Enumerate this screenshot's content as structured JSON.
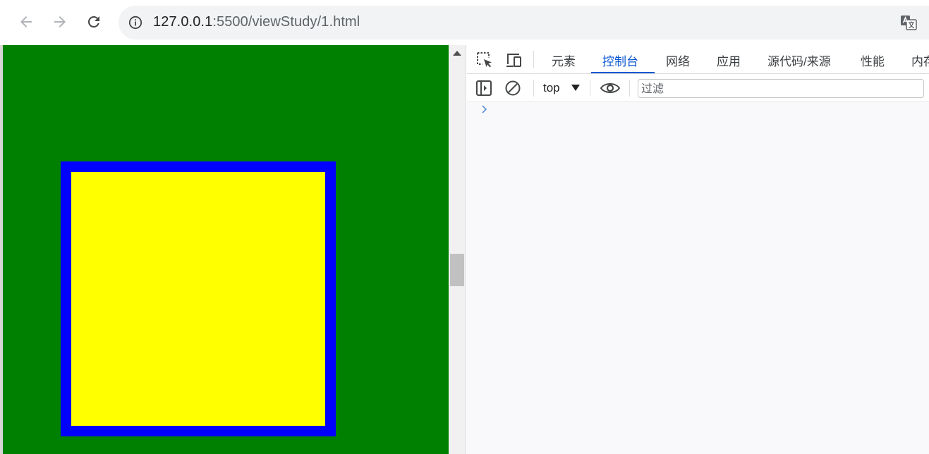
{
  "browser": {
    "url_host": "127.0.0.1",
    "url_rest": ":5500/viewStudy/1.html"
  },
  "icons": {
    "back": "arrow-left-icon",
    "forward": "arrow-right-icon",
    "reload": "reload-icon",
    "info": "info-icon",
    "translate": "translate-icon",
    "inspect": "inspect-element-icon",
    "device": "device-toolbar-icon",
    "sidebar": "sidebar-toggle-icon",
    "clear": "clear-console-icon",
    "eye": "live-expression-eye-icon",
    "prompt": "chevron-right-icon"
  },
  "page": {
    "background_color": "#008000",
    "outer_box_color": "#0000ff",
    "inner_box_color": "#ffff00"
  },
  "devtools": {
    "tabs": [
      {
        "label": "元素",
        "active": false
      },
      {
        "label": "控制台",
        "active": true
      },
      {
        "label": "网络",
        "active": false
      },
      {
        "label": "应用",
        "active": false
      },
      {
        "label": "源代码/来源",
        "active": false
      },
      {
        "label": "性能",
        "active": false
      },
      {
        "label": "内存",
        "active": false
      }
    ],
    "context": "top",
    "filter_placeholder": "过滤",
    "accent_color": "#0b57d0"
  }
}
